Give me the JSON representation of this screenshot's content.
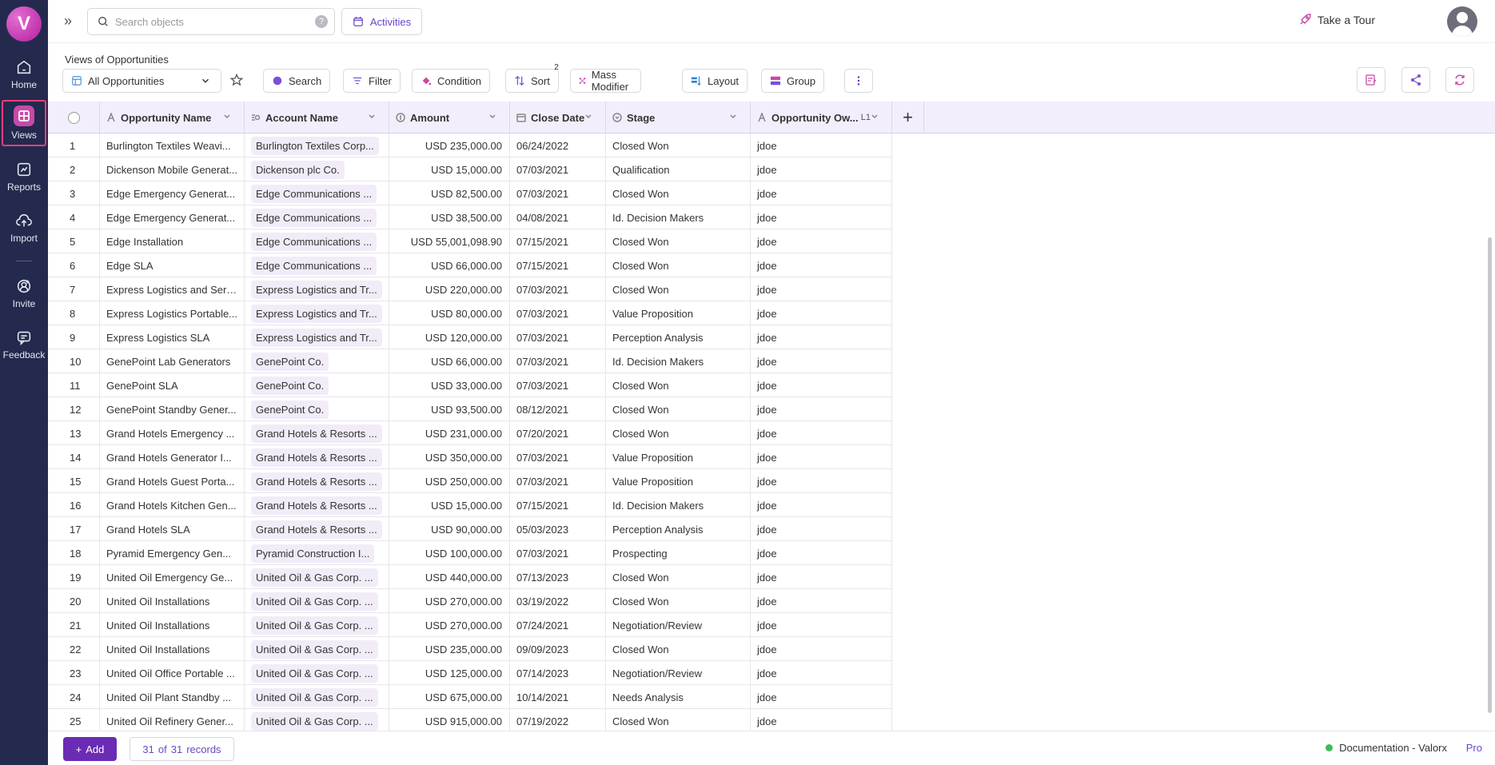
{
  "sidebar": {
    "logo": "V",
    "items": [
      {
        "label": "Home",
        "icon": "home-icon"
      },
      {
        "label": "Views",
        "icon": "views-icon"
      },
      {
        "label": "Reports",
        "icon": "reports-icon"
      },
      {
        "label": "Import",
        "icon": "import-icon"
      },
      {
        "label": "Invite",
        "icon": "invite-icon"
      },
      {
        "label": "Feedback",
        "icon": "feedback-icon"
      }
    ]
  },
  "topbar": {
    "search_placeholder": "Search objects",
    "help": "?",
    "activities": "Activities",
    "tour": "Take a Tour"
  },
  "view": {
    "label": "Views of Opportunities",
    "selected": "All Opportunities"
  },
  "toolbar": {
    "search": "Search",
    "filter": "Filter",
    "condition": "Condition",
    "sort": "Sort",
    "sort_count": "2",
    "mass_modifier": "Mass Modifier",
    "layout": "Layout",
    "group": "Group"
  },
  "columns": {
    "opportunity_name": "Opportunity Name",
    "account_name": "Account Name",
    "amount": "Amount",
    "close_date": "Close Date",
    "stage": "Stage",
    "owner": "Opportunity Ow...",
    "owner_suffix": "L1"
  },
  "rows": [
    {
      "n": "1",
      "opp": "Burlington Textiles Weavi...",
      "acc": "Burlington Textiles Corp...",
      "amt": "USD 235,000.00",
      "date": "06/24/2022",
      "stage": "Closed Won",
      "owner": "jdoe"
    },
    {
      "n": "2",
      "opp": "Dickenson Mobile Generat...",
      "acc": "Dickenson plc Co.",
      "amt": "USD 15,000.00",
      "date": "07/03/2021",
      "stage": "Qualification",
      "owner": "jdoe"
    },
    {
      "n": "3",
      "opp": "Edge Emergency Generat...",
      "acc": "Edge Communications ...",
      "amt": "USD 82,500.00",
      "date": "07/03/2021",
      "stage": "Closed Won",
      "owner": "jdoe"
    },
    {
      "n": "4",
      "opp": "Edge Emergency Generat...",
      "acc": "Edge Communications ...",
      "amt": "USD 38,500.00",
      "date": "04/08/2021",
      "stage": "Id. Decision Makers",
      "owner": "jdoe"
    },
    {
      "n": "5",
      "opp": "Edge Installation",
      "acc": "Edge Communications ...",
      "amt": "USD 55,001,098.90",
      "date": "07/15/2021",
      "stage": "Closed Won",
      "owner": "jdoe"
    },
    {
      "n": "6",
      "opp": "Edge SLA",
      "acc": "Edge Communications ...",
      "amt": "USD 66,000.00",
      "date": "07/15/2021",
      "stage": "Closed Won",
      "owner": "jdoe"
    },
    {
      "n": "7",
      "opp": "Express Logistics and Serv...",
      "acc": "Express Logistics and Tr...",
      "amt": "USD 220,000.00",
      "date": "07/03/2021",
      "stage": "Closed Won",
      "owner": "jdoe"
    },
    {
      "n": "8",
      "opp": "Express Logistics Portable...",
      "acc": "Express Logistics and Tr...",
      "amt": "USD 80,000.00",
      "date": "07/03/2021",
      "stage": "Value Proposition",
      "owner": "jdoe"
    },
    {
      "n": "9",
      "opp": "Express Logistics SLA",
      "acc": "Express Logistics and Tr...",
      "amt": "USD 120,000.00",
      "date": "07/03/2021",
      "stage": "Perception Analysis",
      "owner": "jdoe"
    },
    {
      "n": "10",
      "opp": "GenePoint Lab Generators",
      "acc": "GenePoint Co.",
      "amt": "USD 66,000.00",
      "date": "07/03/2021",
      "stage": "Id. Decision Makers",
      "owner": "jdoe"
    },
    {
      "n": "11",
      "opp": "GenePoint SLA",
      "acc": "GenePoint Co.",
      "amt": "USD 33,000.00",
      "date": "07/03/2021",
      "stage": "Closed Won",
      "owner": "jdoe"
    },
    {
      "n": "12",
      "opp": "GenePoint Standby Gener...",
      "acc": "GenePoint Co.",
      "amt": "USD 93,500.00",
      "date": "08/12/2021",
      "stage": "Closed Won",
      "owner": "jdoe"
    },
    {
      "n": "13",
      "opp": "Grand Hotels Emergency ...",
      "acc": "Grand Hotels & Resorts ...",
      "amt": "USD 231,000.00",
      "date": "07/20/2021",
      "stage": "Closed Won",
      "owner": "jdoe"
    },
    {
      "n": "14",
      "opp": "Grand Hotels Generator I...",
      "acc": "Grand Hotels & Resorts ...",
      "amt": "USD 350,000.00",
      "date": "07/03/2021",
      "stage": "Value Proposition",
      "owner": "jdoe"
    },
    {
      "n": "15",
      "opp": "Grand Hotels Guest Porta...",
      "acc": "Grand Hotels & Resorts ...",
      "amt": "USD 250,000.00",
      "date": "07/03/2021",
      "stage": "Value Proposition",
      "owner": "jdoe"
    },
    {
      "n": "16",
      "opp": "Grand Hotels Kitchen Gen...",
      "acc": "Grand Hotels & Resorts ...",
      "amt": "USD 15,000.00",
      "date": "07/15/2021",
      "stage": "Id. Decision Makers",
      "owner": "jdoe"
    },
    {
      "n": "17",
      "opp": "Grand Hotels SLA",
      "acc": "Grand Hotels & Resorts ...",
      "amt": "USD 90,000.00",
      "date": "05/03/2023",
      "stage": "Perception Analysis",
      "owner": "jdoe"
    },
    {
      "n": "18",
      "opp": "Pyramid Emergency Gen...",
      "acc": "Pyramid Construction I...",
      "amt": "USD 100,000.00",
      "date": "07/03/2021",
      "stage": "Prospecting",
      "owner": "jdoe"
    },
    {
      "n": "19",
      "opp": "United Oil Emergency Ge...",
      "acc": "United Oil & Gas Corp. ...",
      "amt": "USD 440,000.00",
      "date": "07/13/2023",
      "stage": "Closed Won",
      "owner": "jdoe"
    },
    {
      "n": "20",
      "opp": "United Oil Installations",
      "acc": "United Oil & Gas Corp. ...",
      "amt": "USD 270,000.00",
      "date": "03/19/2022",
      "stage": "Closed Won",
      "owner": "jdoe"
    },
    {
      "n": "21",
      "opp": "United Oil Installations",
      "acc": "United Oil & Gas Corp. ...",
      "amt": "USD 270,000.00",
      "date": "07/24/2021",
      "stage": "Negotiation/Review",
      "owner": "jdoe"
    },
    {
      "n": "22",
      "opp": "United Oil Installations",
      "acc": "United Oil & Gas Corp. ...",
      "amt": "USD 235,000.00",
      "date": "09/09/2023",
      "stage": "Closed Won",
      "owner": "jdoe"
    },
    {
      "n": "23",
      "opp": "United Oil Office Portable ...",
      "acc": "United Oil & Gas Corp. ...",
      "amt": "USD 125,000.00",
      "date": "07/14/2023",
      "stage": "Negotiation/Review",
      "owner": "jdoe"
    },
    {
      "n": "24",
      "opp": "United Oil Plant Standby ...",
      "acc": "United Oil & Gas Corp. ...",
      "amt": "USD 675,000.00",
      "date": "10/14/2021",
      "stage": "Needs Analysis",
      "owner": "jdoe"
    },
    {
      "n": "25",
      "opp": "United Oil Refinery Gener...",
      "acc": "United Oil & Gas Corp. ...",
      "amt": "USD 915,000.00",
      "date": "07/19/2022",
      "stage": "Closed Won",
      "owner": "jdoe"
    }
  ],
  "footer": {
    "add": "Add",
    "records_shown": "31",
    "records_of": "of",
    "records_total": "31",
    "records_word": "records",
    "doc": "Documentation - Valorx",
    "plan": "Pro"
  },
  "colors": {
    "sidebar": "#232a4d",
    "accent": "#6a2bb5",
    "active_border": "#e9407a",
    "header_bg": "#f3eefb"
  }
}
